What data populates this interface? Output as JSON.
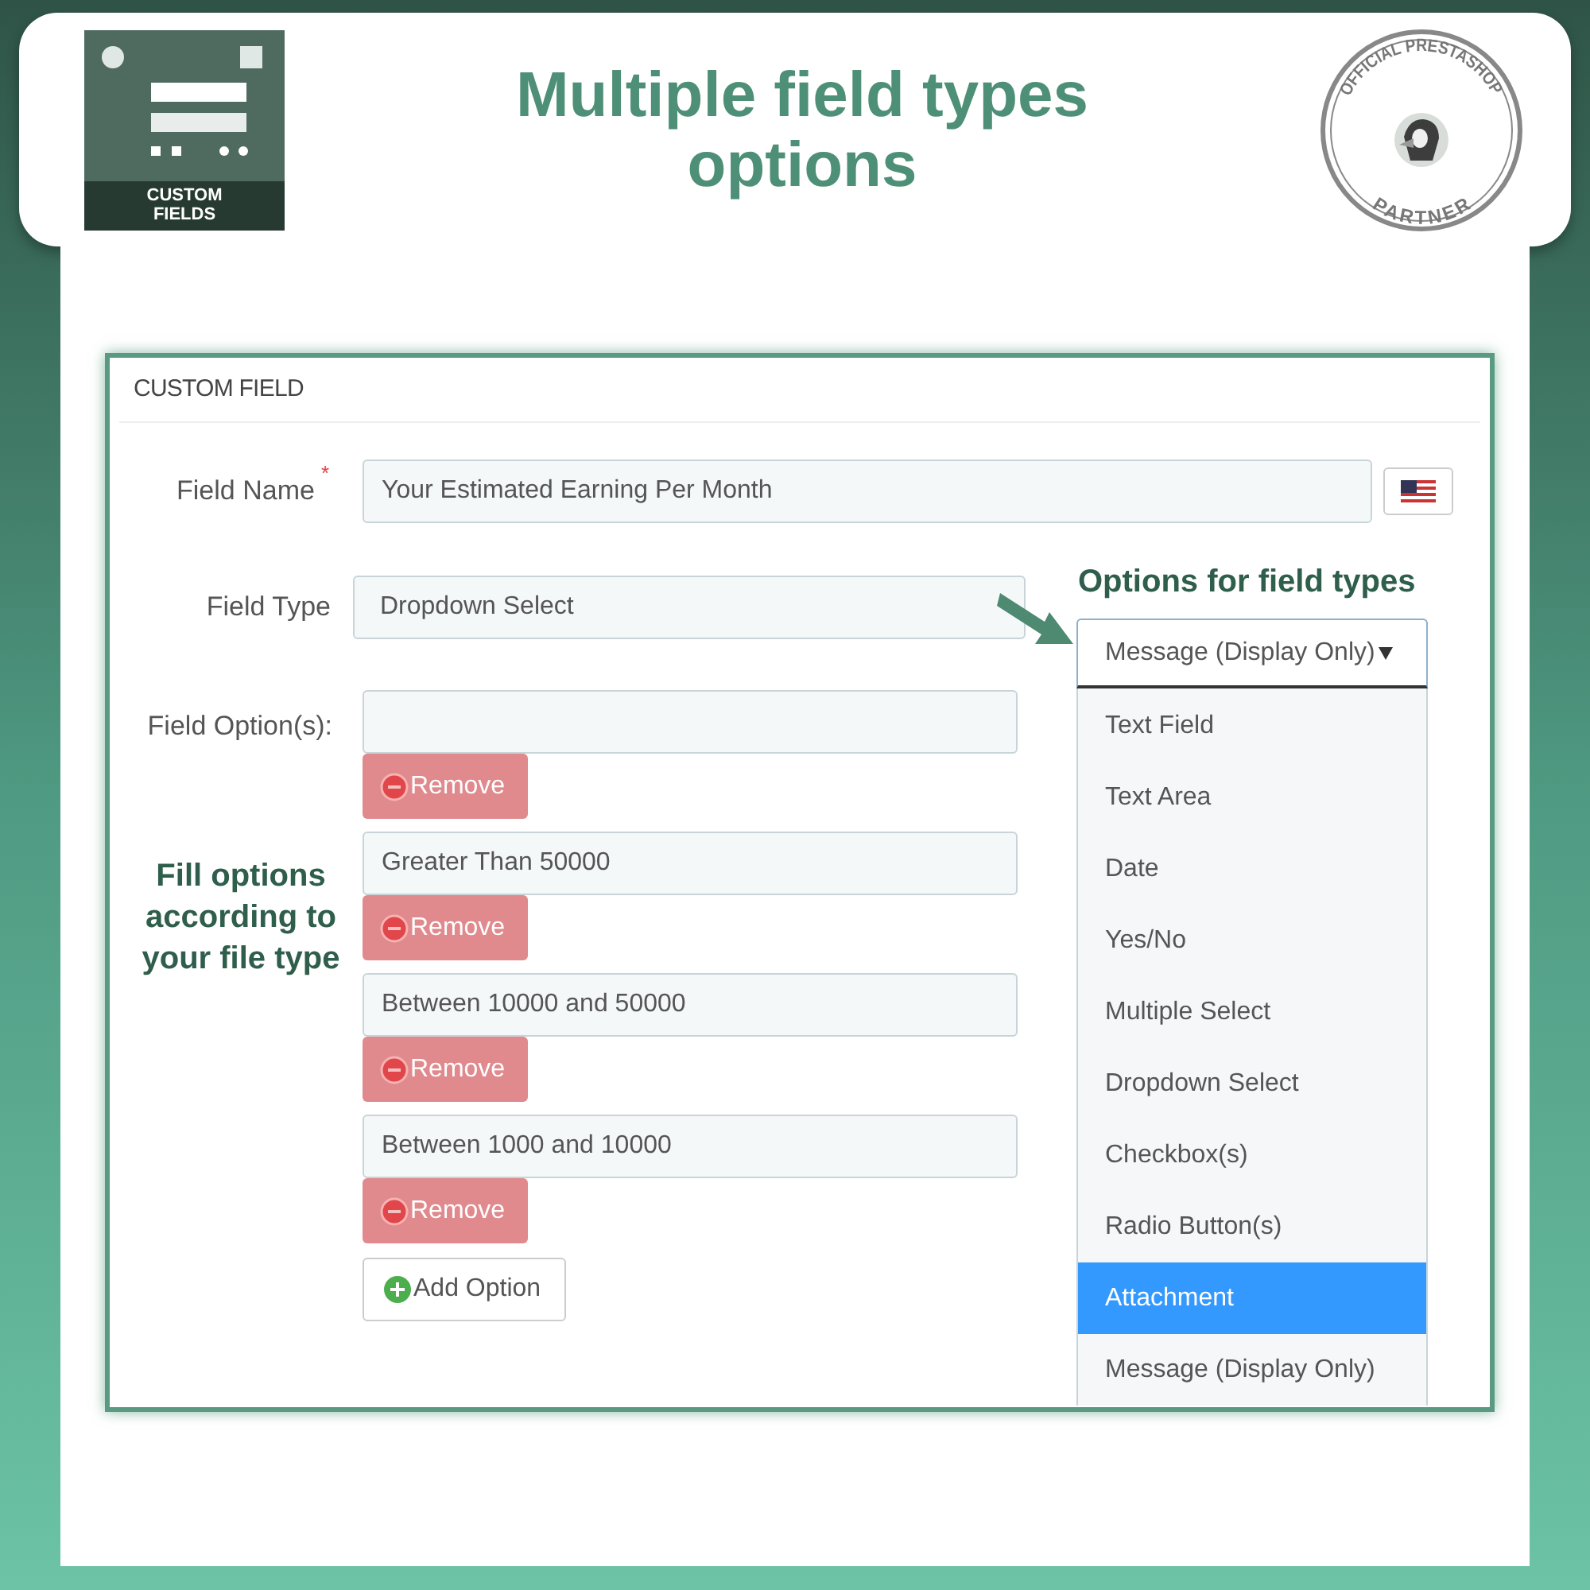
{
  "banner": {
    "product_logo": {
      "caption": "CUSTOM FIELDS"
    },
    "title": "Multiple field types options",
    "badge": {
      "top_text": "OFFICIAL PRESTASHOP",
      "bottom_text": "PARTNER"
    }
  },
  "panel": {
    "title": "CUSTOM FIELD",
    "field_name": {
      "label": "Field Name",
      "required_mark": "*",
      "value": "Your Estimated Earning Per Month"
    },
    "field_type": {
      "label": "Field Type",
      "value": "Dropdown Select"
    },
    "field_options": {
      "label": "Field Option(s):",
      "options": [
        {
          "remove_label": "Remove"
        },
        {
          "value": "Greater Than 50000",
          "remove_label": "Remove"
        },
        {
          "value": "Between 10000 and 50000",
          "remove_label": "Remove"
        },
        {
          "value": "Between 1000 and 10000",
          "remove_label": "Remove"
        }
      ],
      "add_button": "Add Option"
    }
  },
  "callouts": {
    "options_note": "Options for field types",
    "fill_note": "Fill options according to your file type"
  },
  "type_dropdown": {
    "value": "Message (Display Only)",
    "items": [
      {
        "label": "Text Field",
        "highlighted": false
      },
      {
        "label": "Text Area",
        "highlighted": false
      },
      {
        "label": "Date",
        "highlighted": false
      },
      {
        "label": "Yes/No",
        "highlighted": false
      },
      {
        "label": "Multiple Select",
        "highlighted": false
      },
      {
        "label": "Dropdown Select",
        "highlighted": false
      },
      {
        "label": "Checkbox(s)",
        "highlighted": false
      },
      {
        "label": "Radio Button(s)",
        "highlighted": false
      },
      {
        "label": "Attachment",
        "highlighted": true
      },
      {
        "label": "Message (Display Only)",
        "highlighted": false
      }
    ]
  }
}
